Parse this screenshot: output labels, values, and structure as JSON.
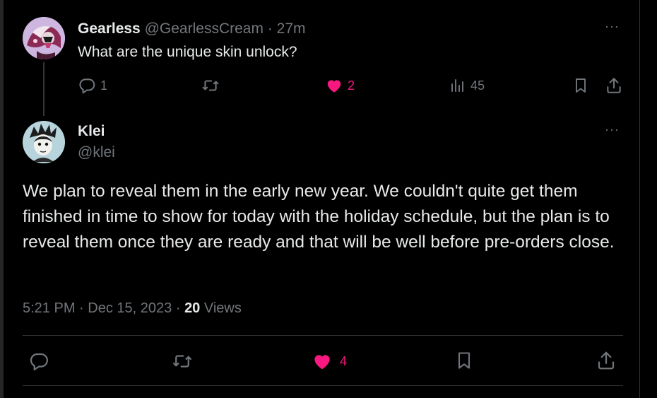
{
  "parent_post": {
    "display_name": "Gearless",
    "handle": "@GearlessCream",
    "separator": "·",
    "time_ago": "27m",
    "text": "What are the unique skin unlock?",
    "reply_count": "1",
    "like_count": "2",
    "view_count": "45",
    "more_label": "···"
  },
  "main_post": {
    "display_name": "Klei",
    "handle": "@klei",
    "text": "We plan to reveal them in the early new year. We couldn't quite get them finished in time to show for today with the holiday schedule, but the plan is to reveal them once they are ready and that will be well before pre-orders close.",
    "time": "5:21 PM",
    "separator": "·",
    "date": "Dec 15, 2023",
    "views_count": "20",
    "views_label": "Views",
    "like_count": "4",
    "more_label": "···"
  },
  "colors": {
    "background": "#000000",
    "text": "#e7e9ea",
    "muted": "#71767b",
    "like": "#f91880",
    "divider": "#2f3336"
  },
  "icons": [
    "reply-icon",
    "retweet-icon",
    "heart-icon",
    "views-icon",
    "bookmark-icon",
    "share-icon",
    "more-icon"
  ]
}
